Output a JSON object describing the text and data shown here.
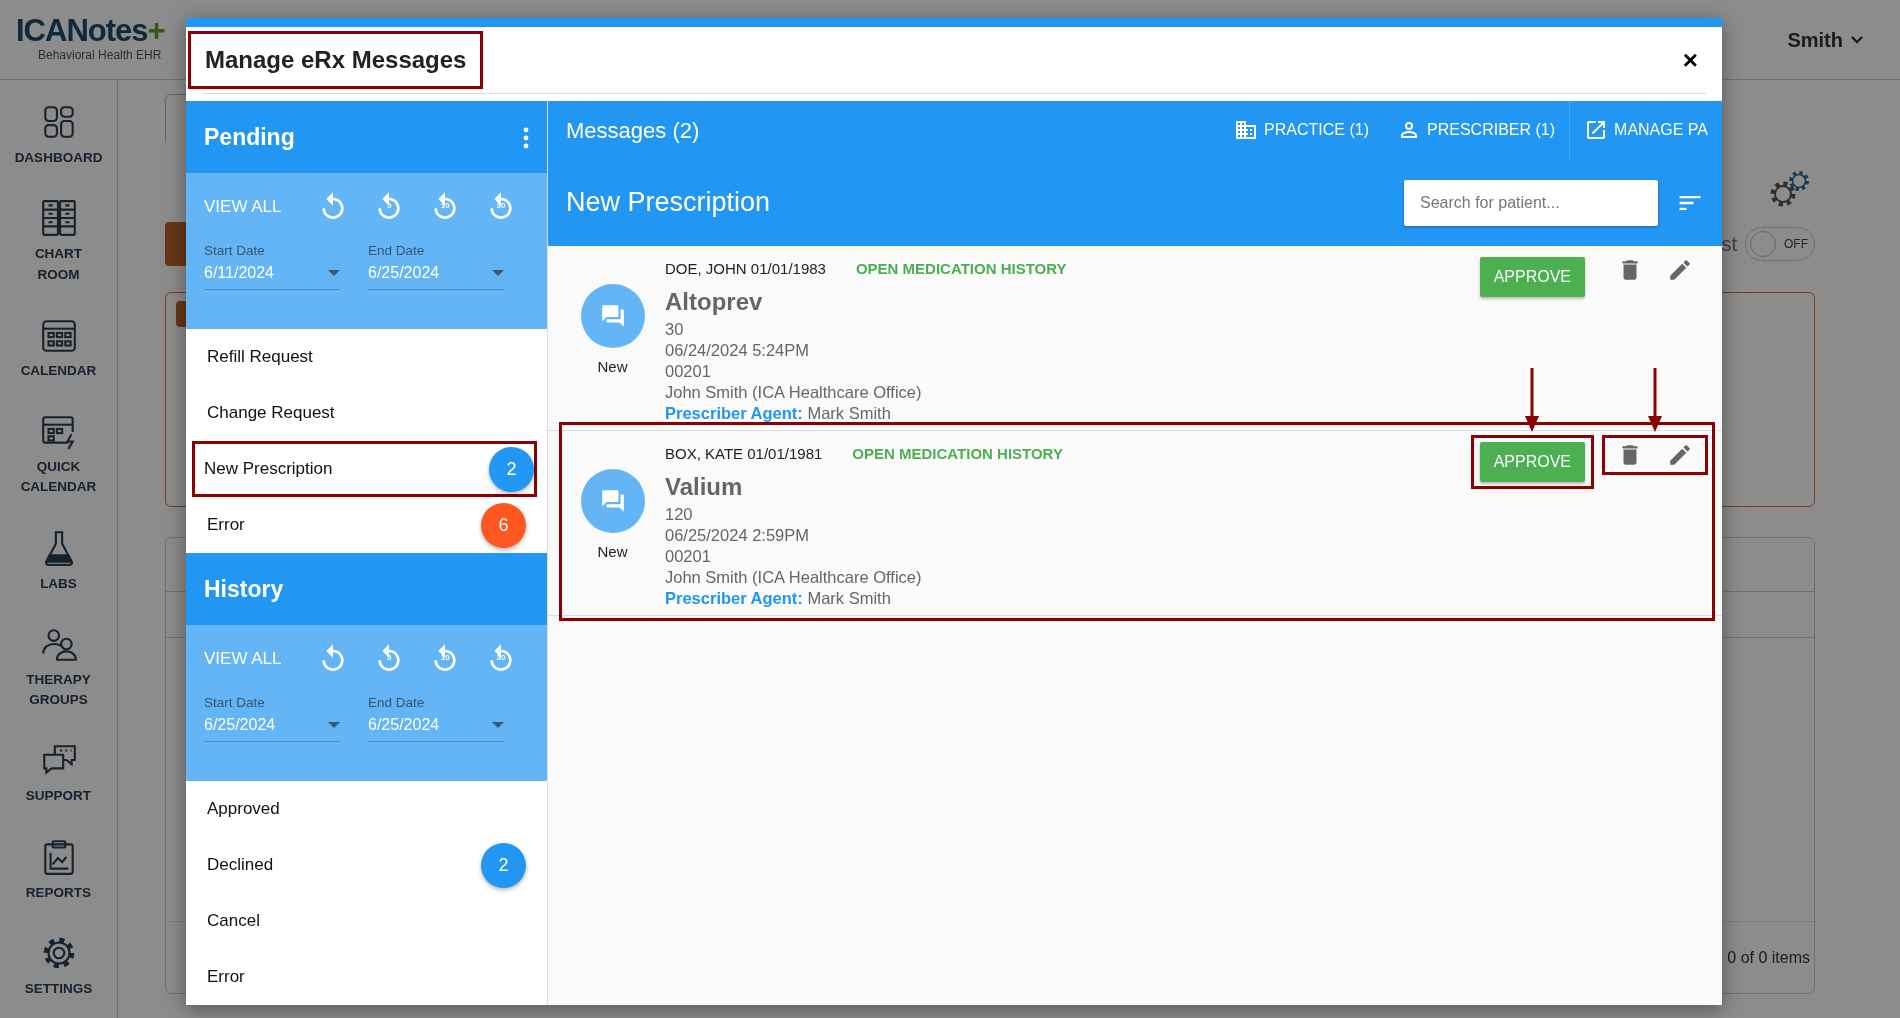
{
  "app": {
    "logo": "ICANotes",
    "logo_plus": "+",
    "logo_sub": "Behavioral Health EHR",
    "user": "Smith",
    "nav": [
      {
        "label": "DASHBOARD",
        "kind": "dashboard"
      },
      {
        "label": "CHART ROOM",
        "kind": "chart"
      },
      {
        "label": "CALENDAR",
        "kind": "calendar"
      },
      {
        "label": "QUICK CALENDAR",
        "kind": "quick"
      },
      {
        "label": "LABS",
        "kind": "labs"
      },
      {
        "label": "THERAPY GROUPS",
        "kind": "groups"
      },
      {
        "label": "SUPPORT",
        "kind": "support"
      },
      {
        "label": "REPORTS",
        "kind": "reports"
      },
      {
        "label": "SETTINGS",
        "kind": "settings"
      }
    ],
    "toggle_label": "st",
    "toggle": {
      "label": "OFF",
      "on": false
    },
    "pager": "0 of 0 items"
  },
  "modal": {
    "title": "Manage eRx Messages",
    "title_highlighted": true,
    "close": "×",
    "sections": [
      {
        "title": "Pending",
        "menu_button": true,
        "view_all": "VIEW ALL",
        "replay_buttons": [
          {
            "kind": "plain"
          },
          {
            "kind": "days",
            "days": "5"
          },
          {
            "kind": "days",
            "days": "10"
          },
          {
            "kind": "days",
            "days": "30"
          }
        ],
        "start_label": "Start Date",
        "start": "6/11/2024",
        "end_label": "End Date",
        "end": "6/25/2024",
        "items": [
          {
            "label": "Refill Request",
            "highlighted": false
          },
          {
            "label": "Change Request",
            "highlighted": false
          },
          {
            "label": "New Prescription",
            "highlighted": true,
            "count": "2",
            "color": "#2196f3"
          },
          {
            "label": "Error",
            "highlighted": false,
            "count": "6",
            "color": "#ff5722"
          }
        ]
      },
      {
        "title": "History",
        "menu_button": false,
        "view_all": "VIEW ALL",
        "replay_buttons": [
          {
            "kind": "plain"
          },
          {
            "kind": "days",
            "days": "5"
          },
          {
            "kind": "days",
            "days": "10"
          },
          {
            "kind": "days",
            "days": "30"
          }
        ],
        "start_label": "Start Date",
        "start": "6/25/2024",
        "end_label": "End Date",
        "end": "6/25/2024",
        "items": [
          {
            "label": "Approved",
            "highlighted": false
          },
          {
            "label": "Declined",
            "highlighted": false,
            "count": "2",
            "color": "#2196f3"
          },
          {
            "label": "Cancel",
            "highlighted": false
          },
          {
            "label": "Error",
            "highlighted": false
          }
        ]
      }
    ],
    "pane": {
      "title": "Messages (2)",
      "filters": [
        {
          "label": "PRACTICE (1)",
          "kind": "practice"
        },
        {
          "label": "PRESCRIBER (1)",
          "kind": "prescriber"
        },
        {
          "label": "MANAGE PA",
          "kind": "external"
        }
      ],
      "subtitle": "New Prescription",
      "search": {
        "placeholder": "Search for patient..."
      },
      "messages": [
        {
          "patient": "DOE, JOHN 01/01/1983",
          "history_link": "OPEN MEDICATION HISTORY",
          "drug": "Altoprev",
          "lines": [
            "30",
            "06/24/2024 5:24PM",
            "00201",
            "John Smith (ICA Healthcare Office)"
          ],
          "agent": "**Prescriber Agent:** Mark Smith",
          "status": "New",
          "approve": "APPROVE",
          "highlighted": false
        },
        {
          "patient": "BOX, KATE 01/01/1981",
          "history_link": "OPEN MEDICATION HISTORY",
          "drug": "Valium",
          "lines": [
            "120",
            "06/25/2024 2:59PM",
            "00201",
            "John Smith (ICA Healthcare Office)"
          ],
          "agent": "**Prescriber Agent:** Mark Smith",
          "status": "New",
          "approve": "APPROVE",
          "highlighted": true
        }
      ]
    }
  }
}
